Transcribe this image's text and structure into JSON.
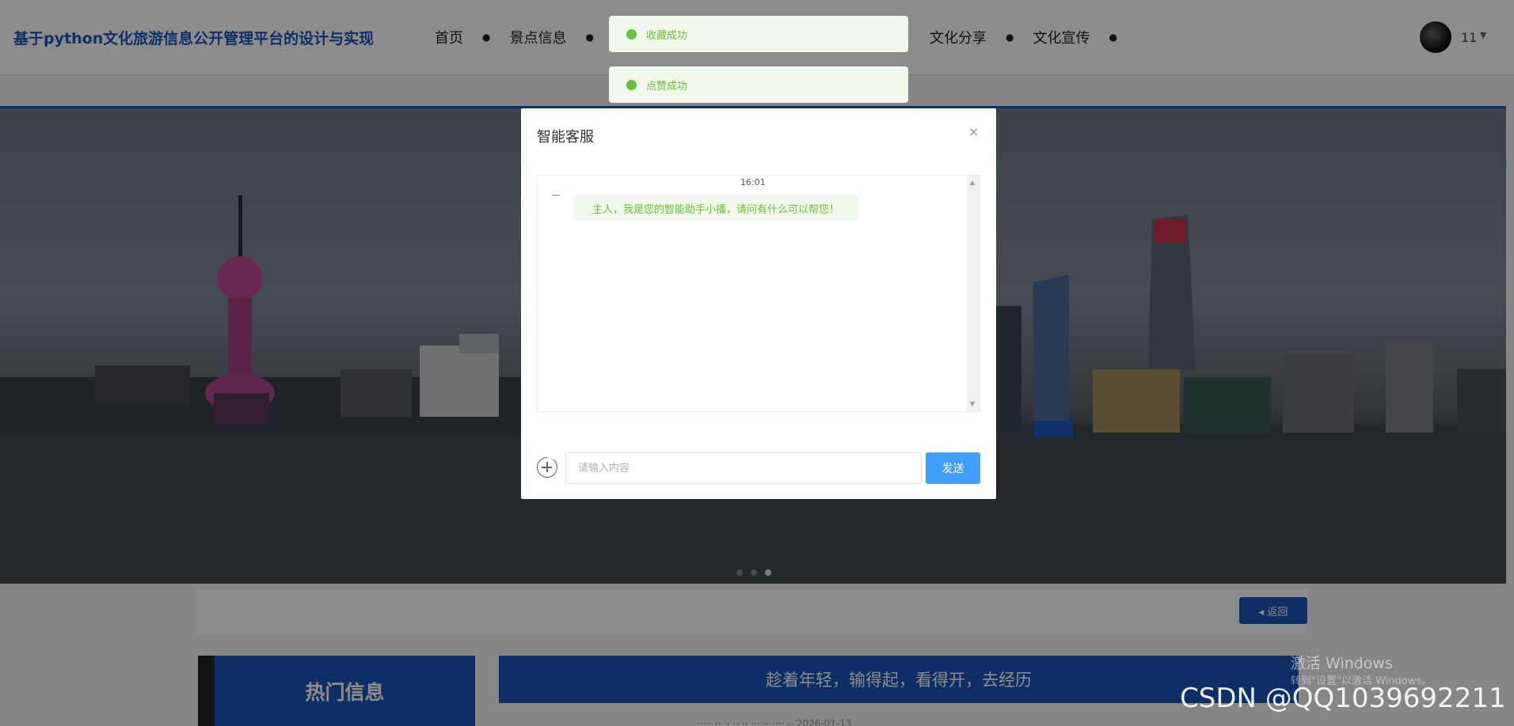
{
  "header": {
    "title": "基于python文化旅游信息公开管理平台的设计与实现",
    "nav": [
      {
        "label": "首页"
      },
      {
        "label": "景点信息"
      },
      {
        "label": "文化分享"
      },
      {
        "label": "文化宣传"
      }
    ],
    "user": {
      "name": "11",
      "caret": "▼"
    }
  },
  "toasts": [
    {
      "text": "收藏成功"
    },
    {
      "text": "点赞成功"
    }
  ],
  "modal": {
    "title": "智能客服",
    "close": "×",
    "chat": {
      "time": "16:01",
      "message": "主人，我是您的智能助手小播，请问有什么可以帮您！"
    },
    "input_placeholder": "请输入内容",
    "send_label": "发送"
  },
  "page": {
    "back_label": "◂ 返回",
    "hot_title": "热门信息",
    "slogan": "趁着年轻，输得起，看得开，去经历",
    "meta": "····· ·· ·· ·· ·· ··· ·· ···· ·· 2026-01-13"
  },
  "watermarks": {
    "windows_title": "激活 Windows",
    "windows_sub": "转到\"设置\"以激活 Windows。",
    "csdn": "CSDN @QQ1039692211"
  },
  "colors": {
    "brand": "#1a56b8",
    "send_button": "#409eff",
    "toast_bg": "#f0f9eb",
    "toast_text": "#67c23a"
  }
}
